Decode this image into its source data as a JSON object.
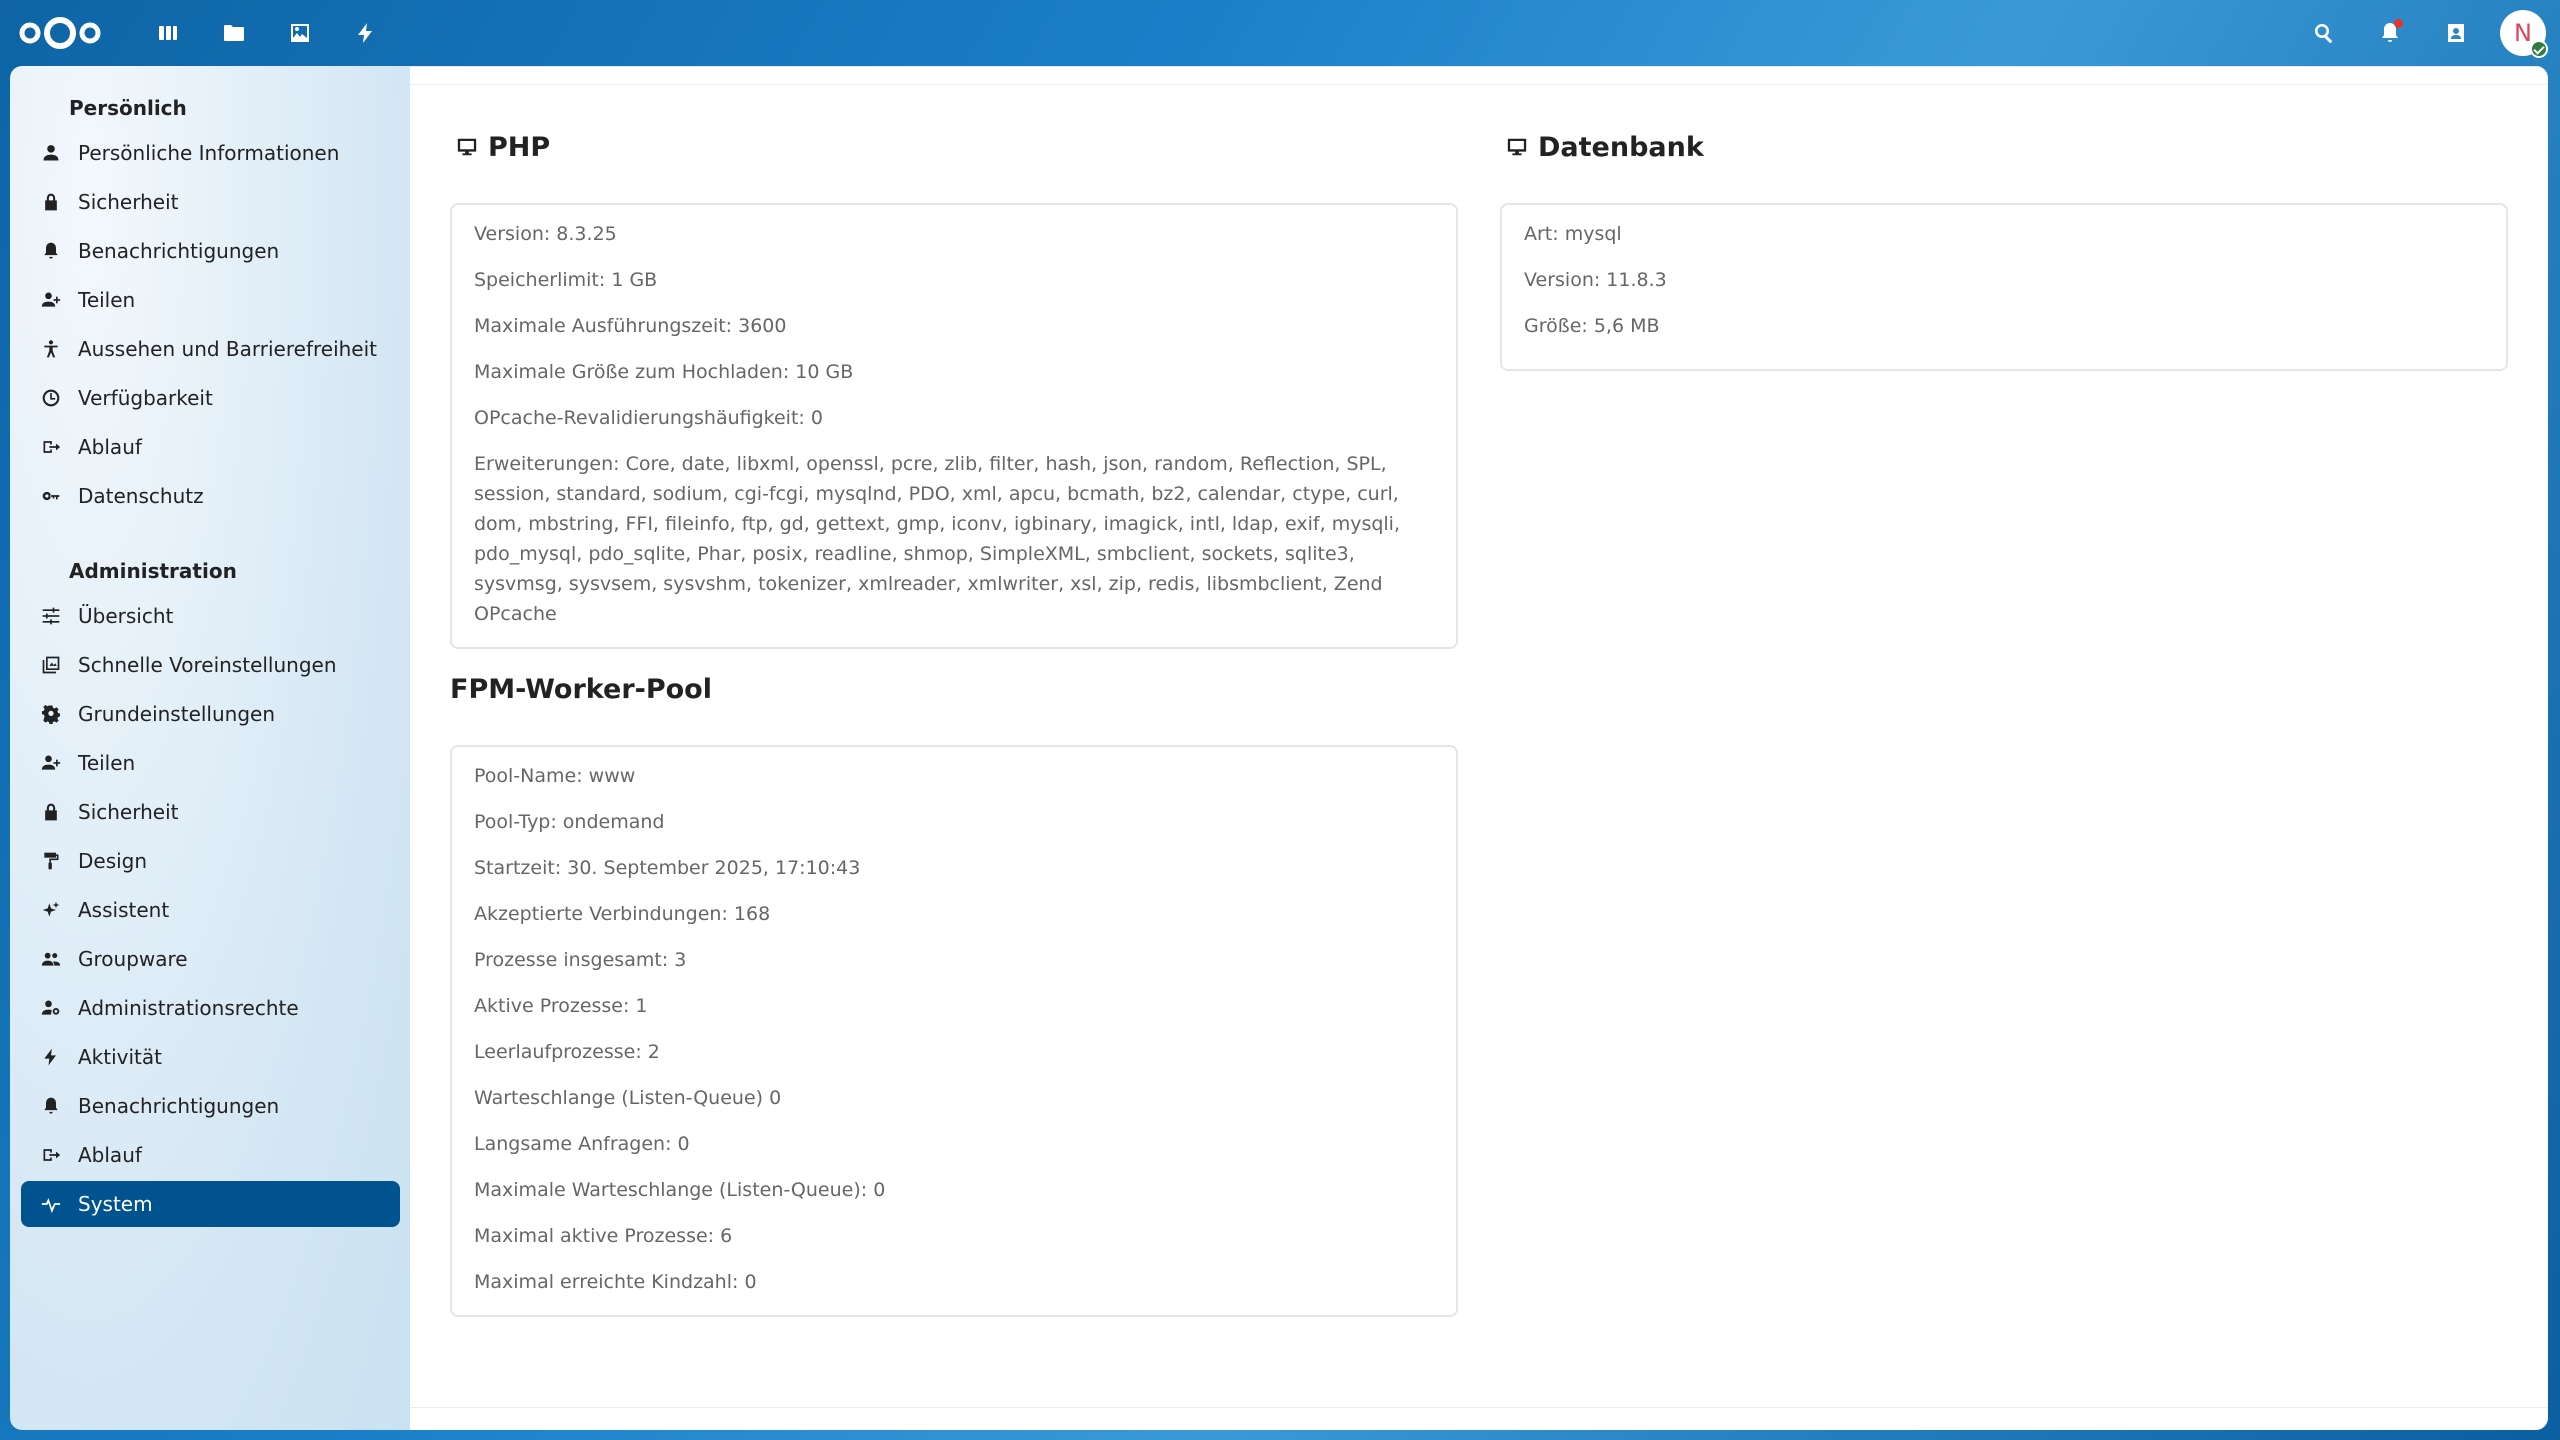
{
  "header": {
    "app_icons": [
      "dashboard-icon",
      "files-icon",
      "photos-icon",
      "activity-icon"
    ],
    "avatar_initial": "N"
  },
  "sidebar": {
    "personal_title": "Persönlich",
    "personal_items": [
      {
        "label": "Persönliche Informationen",
        "icon": "person-icon"
      },
      {
        "label": "Sicherheit",
        "icon": "lock-icon"
      },
      {
        "label": "Benachrichtigungen",
        "icon": "bell-icon"
      },
      {
        "label": "Teilen",
        "icon": "share-icon"
      },
      {
        "label": "Aussehen und Barrierefreiheit",
        "icon": "accessibility-icon"
      },
      {
        "label": "Verfügbarkeit",
        "icon": "clock-icon"
      },
      {
        "label": "Ablauf",
        "icon": "flow-icon"
      },
      {
        "label": "Datenschutz",
        "icon": "key-icon"
      }
    ],
    "admin_title": "Administration",
    "admin_items": [
      {
        "label": "Übersicht",
        "icon": "sliders-icon"
      },
      {
        "label": "Schnelle Voreinstellungen",
        "icon": "presets-icon"
      },
      {
        "label": "Grundeinstellungen",
        "icon": "gear-icon"
      },
      {
        "label": "Teilen",
        "icon": "share-icon"
      },
      {
        "label": "Sicherheit",
        "icon": "lock-icon"
      },
      {
        "label": "Design",
        "icon": "paint-icon"
      },
      {
        "label": "Assistent",
        "icon": "sparkle-icon"
      },
      {
        "label": "Groupware",
        "icon": "group-icon"
      },
      {
        "label": "Administrationsrechte",
        "icon": "admin-rights-icon"
      },
      {
        "label": "Aktivität",
        "icon": "lightning-icon"
      },
      {
        "label": "Benachrichtigungen",
        "icon": "bell-icon"
      },
      {
        "label": "Ablauf",
        "icon": "flow-icon"
      },
      {
        "label": "System",
        "icon": "pulse-icon",
        "active": true
      }
    ]
  },
  "php": {
    "title": "PHP",
    "rows": [
      "Version: 8.3.25",
      "Speicherlimit: 1 GB",
      "Maximale Ausführungszeit: 3600",
      "Maximale Größe zum Hochladen: 10 GB",
      "OPcache-Revalidierungshäufigkeit: 0",
      "Erweiterungen: Core, date, libxml, openssl, pcre, zlib, filter, hash, json, random, Reflection, SPL, session, standard, sodium, cgi-fcgi, mysqlnd, PDO, xml, apcu, bcmath, bz2, calendar, ctype, curl, dom, mbstring, FFI, fileinfo, ftp, gd, gettext, gmp, iconv, igbinary, imagick, intl, ldap, exif, mysqli, pdo_mysql, pdo_sqlite, Phar, posix, readline, shmop, SimpleXML, smbclient, sockets, sqlite3, sysvmsg, sysvsem, sysvshm, tokenizer, xmlreader, xmlwriter, xsl, zip, redis, libsmbclient, Zend OPcache"
    ]
  },
  "fpm": {
    "title": "FPM-Worker-Pool",
    "rows": [
      "Pool-Name: www",
      "Pool-Typ: ondemand",
      "Startzeit: 30. September 2025, 17:10:43",
      "Akzeptierte Verbindungen: 168",
      "Prozesse insgesamt: 3",
      "Aktive Prozesse: 1",
      "Leerlaufprozesse: 2",
      "Warteschlange (Listen-Queue) 0",
      "Langsame Anfragen: 0",
      "Maximale Warteschlange (Listen-Queue): 0",
      "Maximal aktive Prozesse: 6",
      "Maximal erreichte Kindzahl: 0"
    ]
  },
  "database": {
    "title": "Datenbank",
    "rows": [
      "Art: mysql",
      "Version: 11.8.3",
      "Größe: 5,6 MB"
    ]
  }
}
